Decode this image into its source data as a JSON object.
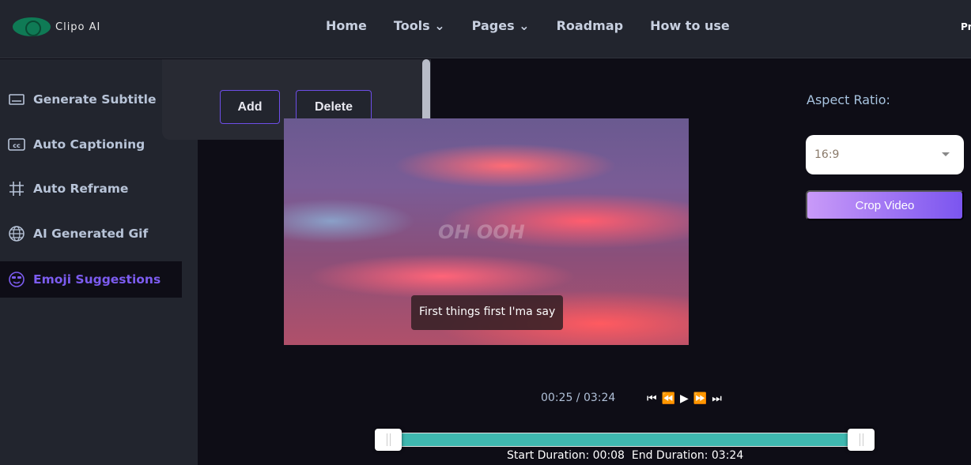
{
  "header": {
    "logo_text": "Clipo AI",
    "nav": [
      "Home",
      "Tools",
      "Pages",
      "Roadmap",
      "How to use"
    ],
    "right_partial": "Pr"
  },
  "sidebar": {
    "items": [
      {
        "label": "Generate Subtitle",
        "icon": "subtitle-icon"
      },
      {
        "label": "Auto Captioning",
        "icon": "cc-icon"
      },
      {
        "label": "Auto Reframe",
        "icon": "frame-icon"
      },
      {
        "label": "AI Generated Gif",
        "icon": "globe-icon"
      },
      {
        "label": "Emoji Suggestions",
        "icon": "emoji-icon",
        "active": true
      }
    ]
  },
  "popup": {
    "add_label": "Add",
    "delete_label": "Delete"
  },
  "video": {
    "watermark": "OH OOH",
    "caption": "First things first I'ma say"
  },
  "player": {
    "time": "00:25 / 03:24",
    "start_duration": "Start Duration: 00:08",
    "end_duration": "End Duration: 03:24"
  },
  "aspect": {
    "label": "Aspect Ratio:",
    "selected": "16:9",
    "crop_label": "Crop Video"
  },
  "colors": {
    "accent": "#7c5cf0",
    "track": "#3fb8b0"
  }
}
